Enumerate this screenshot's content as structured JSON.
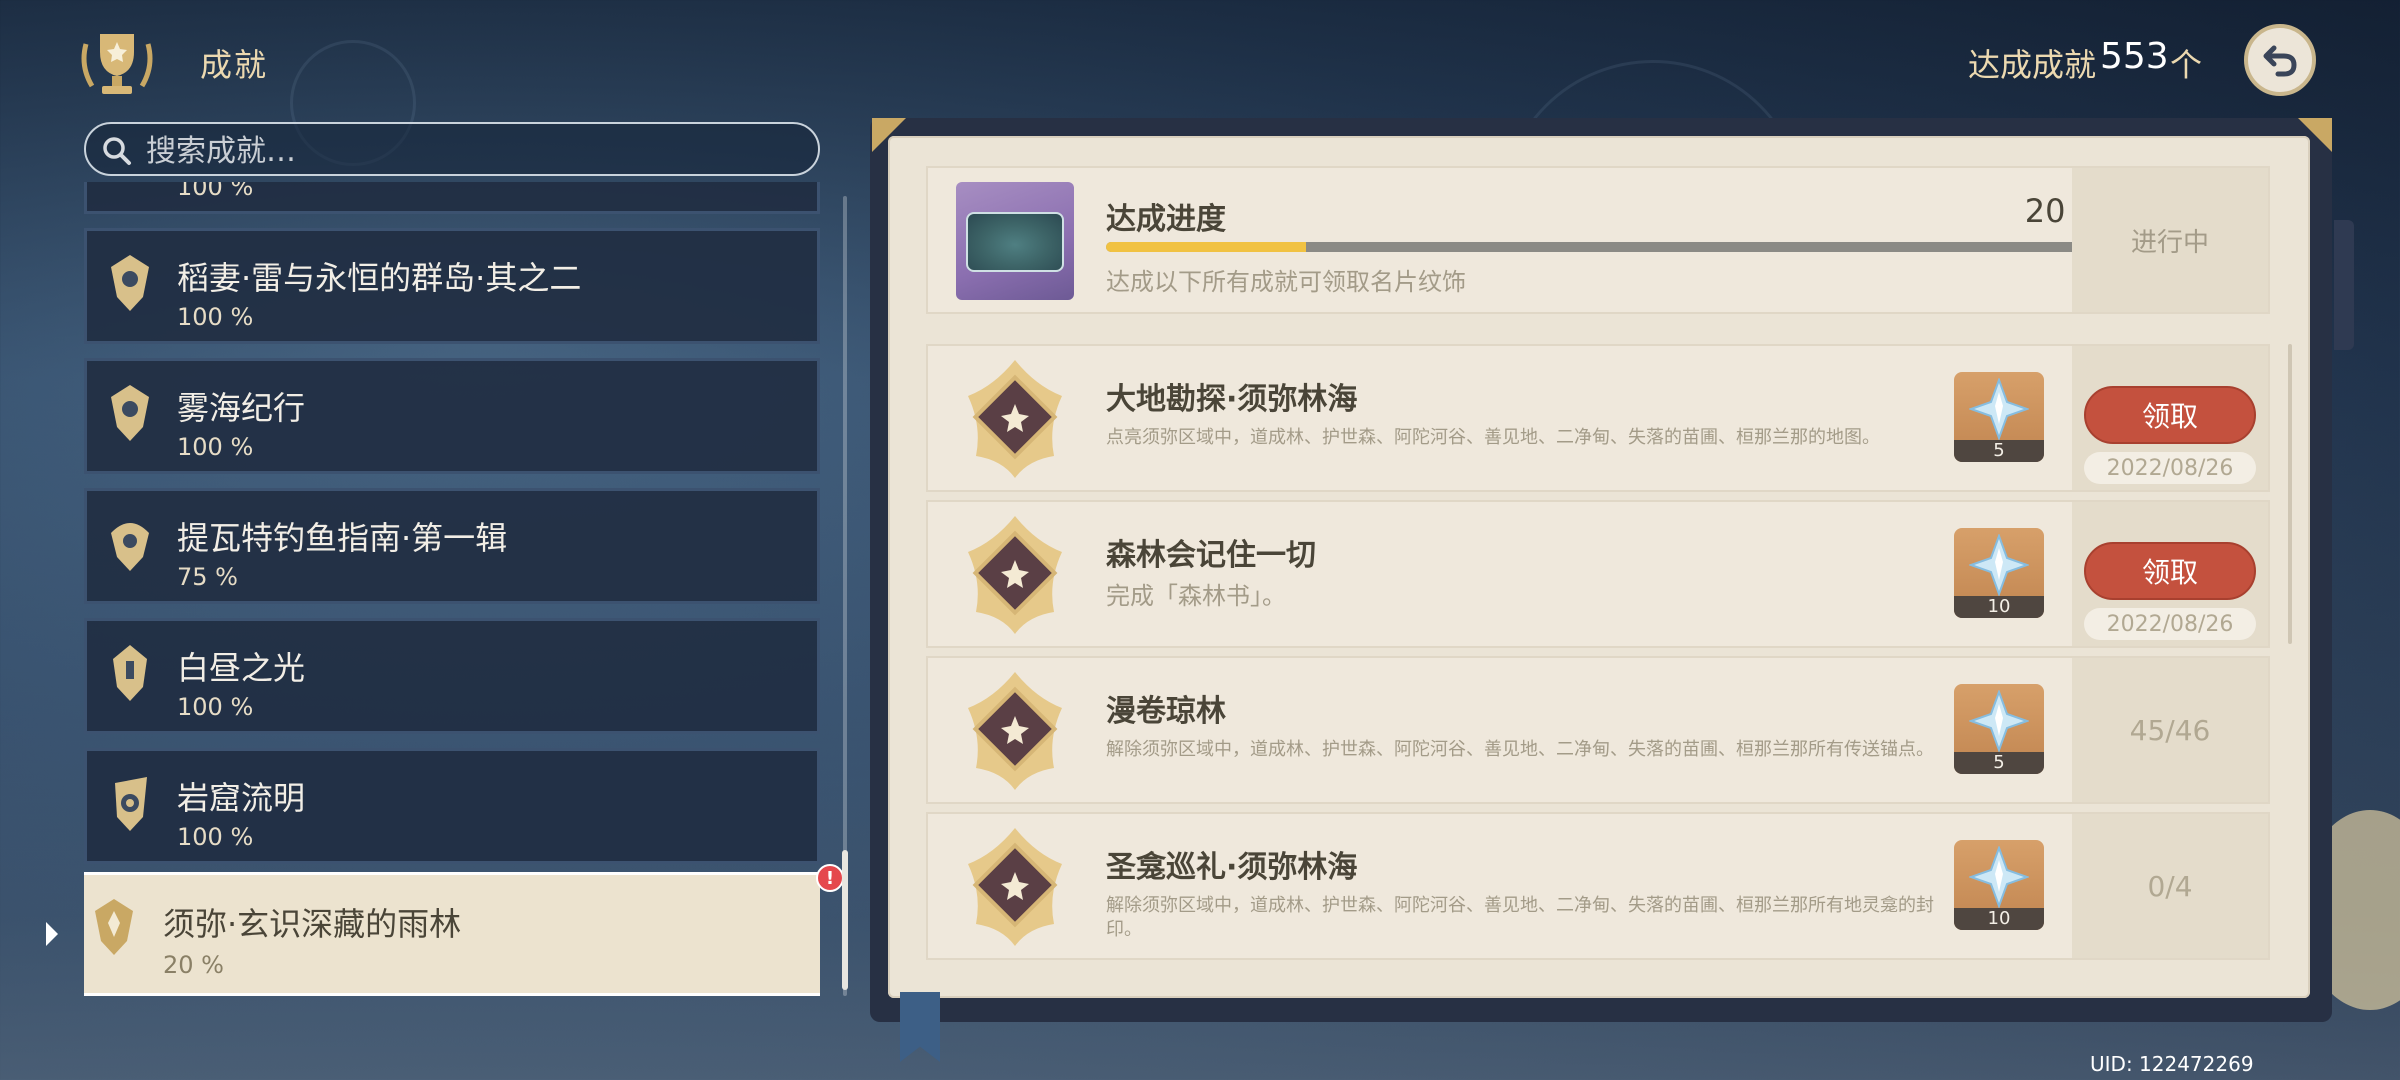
{
  "header": {
    "title": "成就",
    "achieved_label": "达成成就",
    "achieved_count": "553",
    "achieved_unit": "个"
  },
  "search": {
    "placeholder": "搜索成就…",
    "value": ""
  },
  "categories": [
    {
      "name": "",
      "percent": "100 %"
    },
    {
      "name": "稻妻·雷与永恒的群岛·其之二",
      "percent": "100 %"
    },
    {
      "name": "雾海纪行",
      "percent": "100 %"
    },
    {
      "name": "提瓦特钓鱼指南·第一辑",
      "percent": "75 %"
    },
    {
      "name": "白昼之光",
      "percent": "100 %"
    },
    {
      "name": "岩窟流明",
      "percent": "100 %"
    },
    {
      "name": "须弥·玄识深藏的雨林",
      "percent": "20 %",
      "selected": true,
      "alert": "!"
    }
  ],
  "progress": {
    "title": "达成进度",
    "percent_text": "20 %",
    "percent_value": 0.2,
    "description": "达成以下所有成就可领取名片纹饰",
    "status": "进行中"
  },
  "achievements": [
    {
      "name": "大地勘探·须弥林海",
      "description": "点亮须弥区域中，道成林、护世森、阿陀河谷、善见地、二净甸、失落的苗圃、桓那兰那的地图。",
      "reward_qty": "5",
      "action_label": "领取",
      "date": "2022/08/26"
    },
    {
      "name": "森林会记住一切",
      "description": "完成「森林书」。",
      "reward_qty": "10",
      "action_label": "领取",
      "date": "2022/08/26"
    },
    {
      "name": "漫卷琼林",
      "description": "解除须弥区域中，道成林、护世森、阿陀河谷、善见地、二净甸、失落的苗圃、桓那兰那所有传送锚点。",
      "reward_qty": "5",
      "progress": "45/46"
    },
    {
      "name": "圣龛巡礼·须弥林海",
      "description": "解除须弥区域中，道成林、护世森、阿陀河谷、善见地、二净甸、失落的苗圃、桓那兰那所有地灵龛的封印。",
      "reward_qty": "10",
      "progress": "0/4"
    }
  ],
  "footer": {
    "uid": "UID: 122472269"
  },
  "colors": {
    "accent_gold": "#f1c242",
    "claim_red": "#c4513e",
    "panel_cream": "#ebe4d6",
    "category_dark": "#212e42"
  },
  "icons": [
    "trophy-icon",
    "back-arrow-icon",
    "search-icon",
    "category-emblem-icon",
    "achievement-medal-icon",
    "primogem-icon"
  ]
}
